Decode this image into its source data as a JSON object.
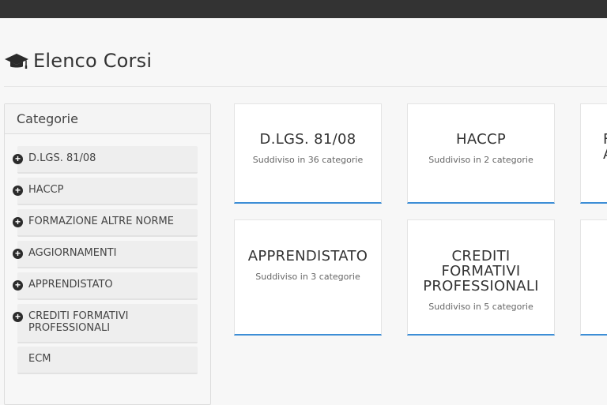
{
  "page_title": "Elenco Corsi",
  "sidebar": {
    "header": "Categorie",
    "items": [
      {
        "label": "D.LGS. 81/08",
        "has_icon": true
      },
      {
        "label": "HACCP",
        "has_icon": true
      },
      {
        "label": "FORMAZIONE ALTRE NORME",
        "has_icon": true
      },
      {
        "label": "AGGIORNAMENTI",
        "has_icon": true
      },
      {
        "label": "APPRENDISTATO",
        "has_icon": true
      },
      {
        "label": "CREDITI FORMATIVI\nPROFESSIONALI",
        "has_icon": true
      },
      {
        "label": "ECM",
        "has_icon": false
      }
    ]
  },
  "cards": [
    {
      "title": "D.LGS. 81/08",
      "subtitle": "Suddiviso in 36 categorie"
    },
    {
      "title": "HACCP",
      "subtitle": "Suddiviso in 2 categorie"
    },
    {
      "title": "F\nA",
      "subtitle": ""
    },
    {
      "title": "APPRENDISTATO",
      "subtitle": "Suddiviso in 3 categorie"
    },
    {
      "title": "CREDITI\nFORMATIVI\nPROFESSIONALI",
      "subtitle": "Suddiviso in 5 categorie"
    },
    {
      "title": "",
      "subtitle": ""
    }
  ],
  "icons": {
    "title": "graduation-cap-icon",
    "expand": "plus-circle-icon"
  },
  "colors": {
    "topbar": "#333333",
    "card_accent": "#3d8ed6",
    "background": "#f7f7f7"
  }
}
